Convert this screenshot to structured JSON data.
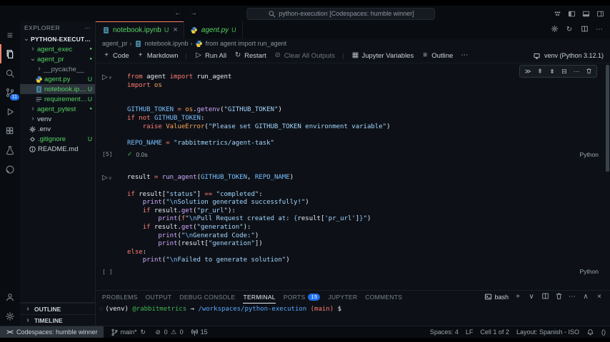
{
  "theme": {
    "accent_orange": "#f78166",
    "untracked_green": "#56d364",
    "badge_blue": "#1f6feb",
    "terminal_green": "#3fb950",
    "terminal_blue": "#58a6ff",
    "terminal_red": "#ff7b72"
  },
  "window": {
    "search_title": "python-execution [Codespaces: humble winner]",
    "nav_back": "←",
    "nav_forward": "→",
    "layout_icons": [
      "grid-dots",
      "layout-left",
      "layout-panel",
      "layout-right"
    ]
  },
  "activity_bar": {
    "items": [
      {
        "name": "menu",
        "icon": "menu"
      },
      {
        "name": "explorer",
        "icon": "files",
        "active": true
      },
      {
        "name": "search",
        "icon": "search"
      },
      {
        "name": "source-control",
        "icon": "branch",
        "badge": "11"
      },
      {
        "name": "run-debug",
        "icon": "debug"
      },
      {
        "name": "extensions",
        "icon": "extensions"
      },
      {
        "name": "testing",
        "icon": "beaker"
      },
      {
        "name": "github",
        "icon": "github"
      }
    ],
    "bottom": [
      {
        "name": "accounts",
        "icon": "account"
      },
      {
        "name": "settings",
        "icon": "gear"
      }
    ]
  },
  "sidebar": {
    "title": "EXPLORER",
    "more": "⋯",
    "tree": [
      {
        "label": "PYTHON-EXECUTION [C...",
        "depth": 0,
        "chevron": "down",
        "bold": true,
        "color": "default"
      },
      {
        "label": "agent_exec",
        "depth": 1,
        "chevron": "right",
        "color": "green",
        "marker": "dot"
      },
      {
        "label": "agent_pr",
        "depth": 1,
        "chevron": "down",
        "color": "green",
        "marker": "dot"
      },
      {
        "label": "__pycache__",
        "depth": 2,
        "chevron": "right",
        "color": "muted"
      },
      {
        "label": "agent.py",
        "depth": 2,
        "icon": "python",
        "color": "green",
        "marker": "U"
      },
      {
        "label": "notebook.ipynb",
        "depth": 2,
        "icon": "notebook",
        "color": "green",
        "marker": "U",
        "selected": true
      },
      {
        "label": "requirements....",
        "depth": 2,
        "icon": "listfile",
        "color": "green",
        "marker": "U"
      },
      {
        "label": "agent_pytest",
        "depth": 1,
        "chevron": "right",
        "color": "green",
        "marker": "dot"
      },
      {
        "label": "venv",
        "depth": 1,
        "chevron": "right",
        "color": "default"
      },
      {
        "label": ".env",
        "depth": 1,
        "icon": "gearfile",
        "color": "default"
      },
      {
        "label": ".gitignore",
        "depth": 1,
        "icon": "diamond",
        "color": "green",
        "marker": "U"
      },
      {
        "label": "README.md",
        "depth": 1,
        "icon": "info",
        "color": "default"
      }
    ],
    "bottom_sections": [
      {
        "label": "OUTLINE"
      },
      {
        "label": "TIMELINE"
      }
    ]
  },
  "editor": {
    "tabs": [
      {
        "label": "notebook.ipynb",
        "dirty": "U",
        "icon": "notebook",
        "active": true,
        "close": "×"
      },
      {
        "label": "agent.py",
        "dirty": "U",
        "icon": "python",
        "italic": true
      }
    ],
    "actions": [
      "gear",
      "sync",
      "split",
      "ellipsis"
    ],
    "breadcrumb": [
      {
        "label": "agent_pr"
      },
      {
        "label": "notebook.ipynb",
        "icon": "notebook"
      },
      {
        "label": "from agent import run_agent",
        "icon": "symbol"
      }
    ]
  },
  "notebook": {
    "toolbar": [
      {
        "label": "Code",
        "icon": "plus"
      },
      {
        "label": "Markdown",
        "icon": "plus"
      },
      {
        "sep": true
      },
      {
        "label": "Run All",
        "icon": "play"
      },
      {
        "label": "Restart",
        "icon": "restart"
      },
      {
        "label": "Clear All Outputs",
        "icon": "clear",
        "disabled": true
      },
      {
        "sep": true
      },
      {
        "label": "Jupyter Variables",
        "icon": "table"
      },
      {
        "label": "Outline",
        "icon": "list"
      },
      {
        "label": "",
        "icon": "ellipsis"
      }
    ],
    "kernel": {
      "label": "venv (Python 3.12.1)",
      "icon": "kernel"
    },
    "cell_toolbar": [
      "run-row",
      "run-above",
      "run-below",
      "split-cell",
      "ellipsis",
      "trash"
    ],
    "cells": [
      {
        "exec": "[5]",
        "check": "✓",
        "time": "0.0s",
        "lang": "Python",
        "show_toolbar": true,
        "lines": [
          [
            [
              "kw",
              "from"
            ],
            [
              "pl",
              " agent "
            ],
            [
              "kw",
              "import"
            ],
            [
              "pl",
              " run_agent"
            ]
          ],
          [
            [
              "kw",
              "import"
            ],
            [
              "mod",
              " os"
            ]
          ],
          [],
          [],
          [
            [
              "const",
              "GITHUB_TOKEN"
            ],
            [
              "kw",
              " = "
            ],
            [
              "mod",
              "os"
            ],
            [
              "pl",
              "."
            ],
            [
              "fn",
              "getenv"
            ],
            [
              "pl",
              "("
            ],
            [
              "str",
              "\"GITHUB_TOKEN\""
            ],
            [
              "pl",
              ")"
            ]
          ],
          [
            [
              "kw",
              "if"
            ],
            [
              "pl",
              " "
            ],
            [
              "kw",
              "not"
            ],
            [
              "const",
              " GITHUB_TOKEN"
            ],
            [
              "pl",
              ":"
            ]
          ],
          [
            [
              "pl",
              "    "
            ],
            [
              "kw",
              "raise"
            ],
            [
              "mod",
              " ValueError"
            ],
            [
              "pl",
              "("
            ],
            [
              "str",
              "\"Please set GITHUB_TOKEN environment variable\""
            ],
            [
              "pl",
              ")"
            ]
          ],
          [],
          [
            [
              "const",
              "REPO_NAME"
            ],
            [
              "kw",
              " = "
            ],
            [
              "str",
              "\"rabbitmetrics/agent-task\""
            ]
          ]
        ]
      },
      {
        "exec": "[ ]",
        "lang": "Python",
        "lines": [
          [
            [
              "pl",
              "result "
            ],
            [
              "kw",
              "="
            ],
            [
              "pl",
              " "
            ],
            [
              "fn",
              "run_agent"
            ],
            [
              "pl",
              "("
            ],
            [
              "const",
              "GITHUB_TOKEN"
            ],
            [
              "pl",
              ", "
            ],
            [
              "const",
              "REPO_NAME"
            ],
            [
              "pl",
              ")"
            ]
          ],
          [],
          [
            [
              "kw",
              "if"
            ],
            [
              "pl",
              " result["
            ],
            [
              "str",
              "\"status\""
            ],
            [
              "pl",
              "] "
            ],
            [
              "kw",
              "=="
            ],
            [
              "pl",
              " "
            ],
            [
              "str",
              "\"completed\""
            ],
            [
              "pl",
              ":"
            ]
          ],
          [
            [
              "pl",
              "    "
            ],
            [
              "fn",
              "print"
            ],
            [
              "pl",
              "("
            ],
            [
              "str",
              "\""
            ],
            [
              "esc",
              "\\n"
            ],
            [
              "str",
              "Solution generated successfully!\""
            ],
            [
              "pl",
              ")"
            ]
          ],
          [
            [
              "pl",
              "    "
            ],
            [
              "kw",
              "if"
            ],
            [
              "pl",
              " result."
            ],
            [
              "fn",
              "get"
            ],
            [
              "pl",
              "("
            ],
            [
              "str",
              "\"pr_url\""
            ],
            [
              "pl",
              "):"
            ]
          ],
          [
            [
              "pl",
              "        "
            ],
            [
              "fn",
              "print"
            ],
            [
              "pl",
              "("
            ],
            [
              "kw",
              "f"
            ],
            [
              "str",
              "\""
            ],
            [
              "esc",
              "\\n"
            ],
            [
              "str",
              "Pull Request created at: "
            ],
            [
              "esc",
              "{"
            ],
            [
              "pl",
              "result["
            ],
            [
              "str",
              "'pr_url'"
            ],
            [
              "pl",
              "]"
            ],
            [
              "esc",
              "}"
            ],
            [
              "str",
              "\""
            ],
            [
              "pl",
              ")"
            ]
          ],
          [
            [
              "pl",
              "    "
            ],
            [
              "kw",
              "if"
            ],
            [
              "pl",
              " result."
            ],
            [
              "fn",
              "get"
            ],
            [
              "pl",
              "("
            ],
            [
              "str",
              "\"generation\""
            ],
            [
              "pl",
              "):"
            ]
          ],
          [
            [
              "pl",
              "        "
            ],
            [
              "fn",
              "print"
            ],
            [
              "pl",
              "("
            ],
            [
              "str",
              "\""
            ],
            [
              "esc",
              "\\n"
            ],
            [
              "str",
              "Generated Code:\""
            ],
            [
              "pl",
              ")"
            ]
          ],
          [
            [
              "pl",
              "        "
            ],
            [
              "fn",
              "print"
            ],
            [
              "pl",
              "(result["
            ],
            [
              "str",
              "\"generation\""
            ],
            [
              "pl",
              "])"
            ]
          ],
          [
            [
              "kw",
              "else"
            ],
            [
              "pl",
              ":"
            ]
          ],
          [
            [
              "pl",
              "    "
            ],
            [
              "fn",
              "print"
            ],
            [
              "pl",
              "("
            ],
            [
              "str",
              "\""
            ],
            [
              "esc",
              "\\n"
            ],
            [
              "str",
              "Failed to generate solution\""
            ],
            [
              "pl",
              ")"
            ]
          ]
        ]
      }
    ]
  },
  "panel": {
    "tabs": [
      {
        "label": "PROBLEMS"
      },
      {
        "label": "OUTPUT"
      },
      {
        "label": "DEBUG CONSOLE"
      },
      {
        "label": "TERMINAL",
        "active": true
      },
      {
        "label": "PORTS",
        "badge": "15"
      },
      {
        "label": "JUPYTER"
      },
      {
        "label": "COMMENTS"
      }
    ],
    "shell": {
      "label": "bash",
      "icon": "terminal"
    },
    "actions": [
      "plus",
      "chev-down",
      "split",
      "trash",
      "ellipsis",
      "chevron-up",
      "close"
    ],
    "terminal_line": [
      [
        "pl",
        "(venv) "
      ],
      [
        "green",
        "@rabbitmetrics"
      ],
      [
        "pl",
        " → "
      ],
      [
        "blue",
        "/workspaces/python-execution"
      ],
      [
        "red",
        " (main)"
      ],
      [
        "pl",
        " $"
      ]
    ]
  },
  "status_bar": {
    "left": [
      {
        "name": "remote-indicator",
        "chip": true,
        "parts": [
          [
            "icon",
            "remote"
          ],
          [
            "text",
            "Codespaces: humble winner"
          ]
        ]
      },
      {
        "name": "git-branch",
        "parts": [
          [
            "icon",
            "branch"
          ],
          [
            "text",
            "main*"
          ],
          [
            "icon",
            "sync"
          ]
        ]
      },
      {
        "name": "problems",
        "parts": [
          [
            "icon",
            "error"
          ],
          [
            "text",
            "0"
          ],
          [
            "icon",
            "warning"
          ],
          [
            "text",
            "0"
          ]
        ]
      },
      {
        "name": "ports-status",
        "parts": [
          [
            "icon",
            "broadcast"
          ],
          [
            "text",
            "15"
          ]
        ]
      }
    ],
    "right": [
      {
        "name": "indentation",
        "parts": [
          [
            "text",
            "Spaces: 4"
          ]
        ]
      },
      {
        "name": "eol",
        "parts": [
          [
            "text",
            "LF"
          ]
        ]
      },
      {
        "name": "cell-indicator",
        "parts": [
          [
            "text",
            "Cell 1 of 2"
          ]
        ]
      },
      {
        "name": "keyboard-layout",
        "parts": [
          [
            "text",
            "Layout: Spanish - ISO"
          ]
        ]
      },
      {
        "name": "notifications",
        "parts": [
          [
            "icon",
            "bell"
          ]
        ]
      },
      {
        "name": "brackets",
        "parts": [
          [
            "text",
            "()"
          ]
        ]
      }
    ]
  }
}
